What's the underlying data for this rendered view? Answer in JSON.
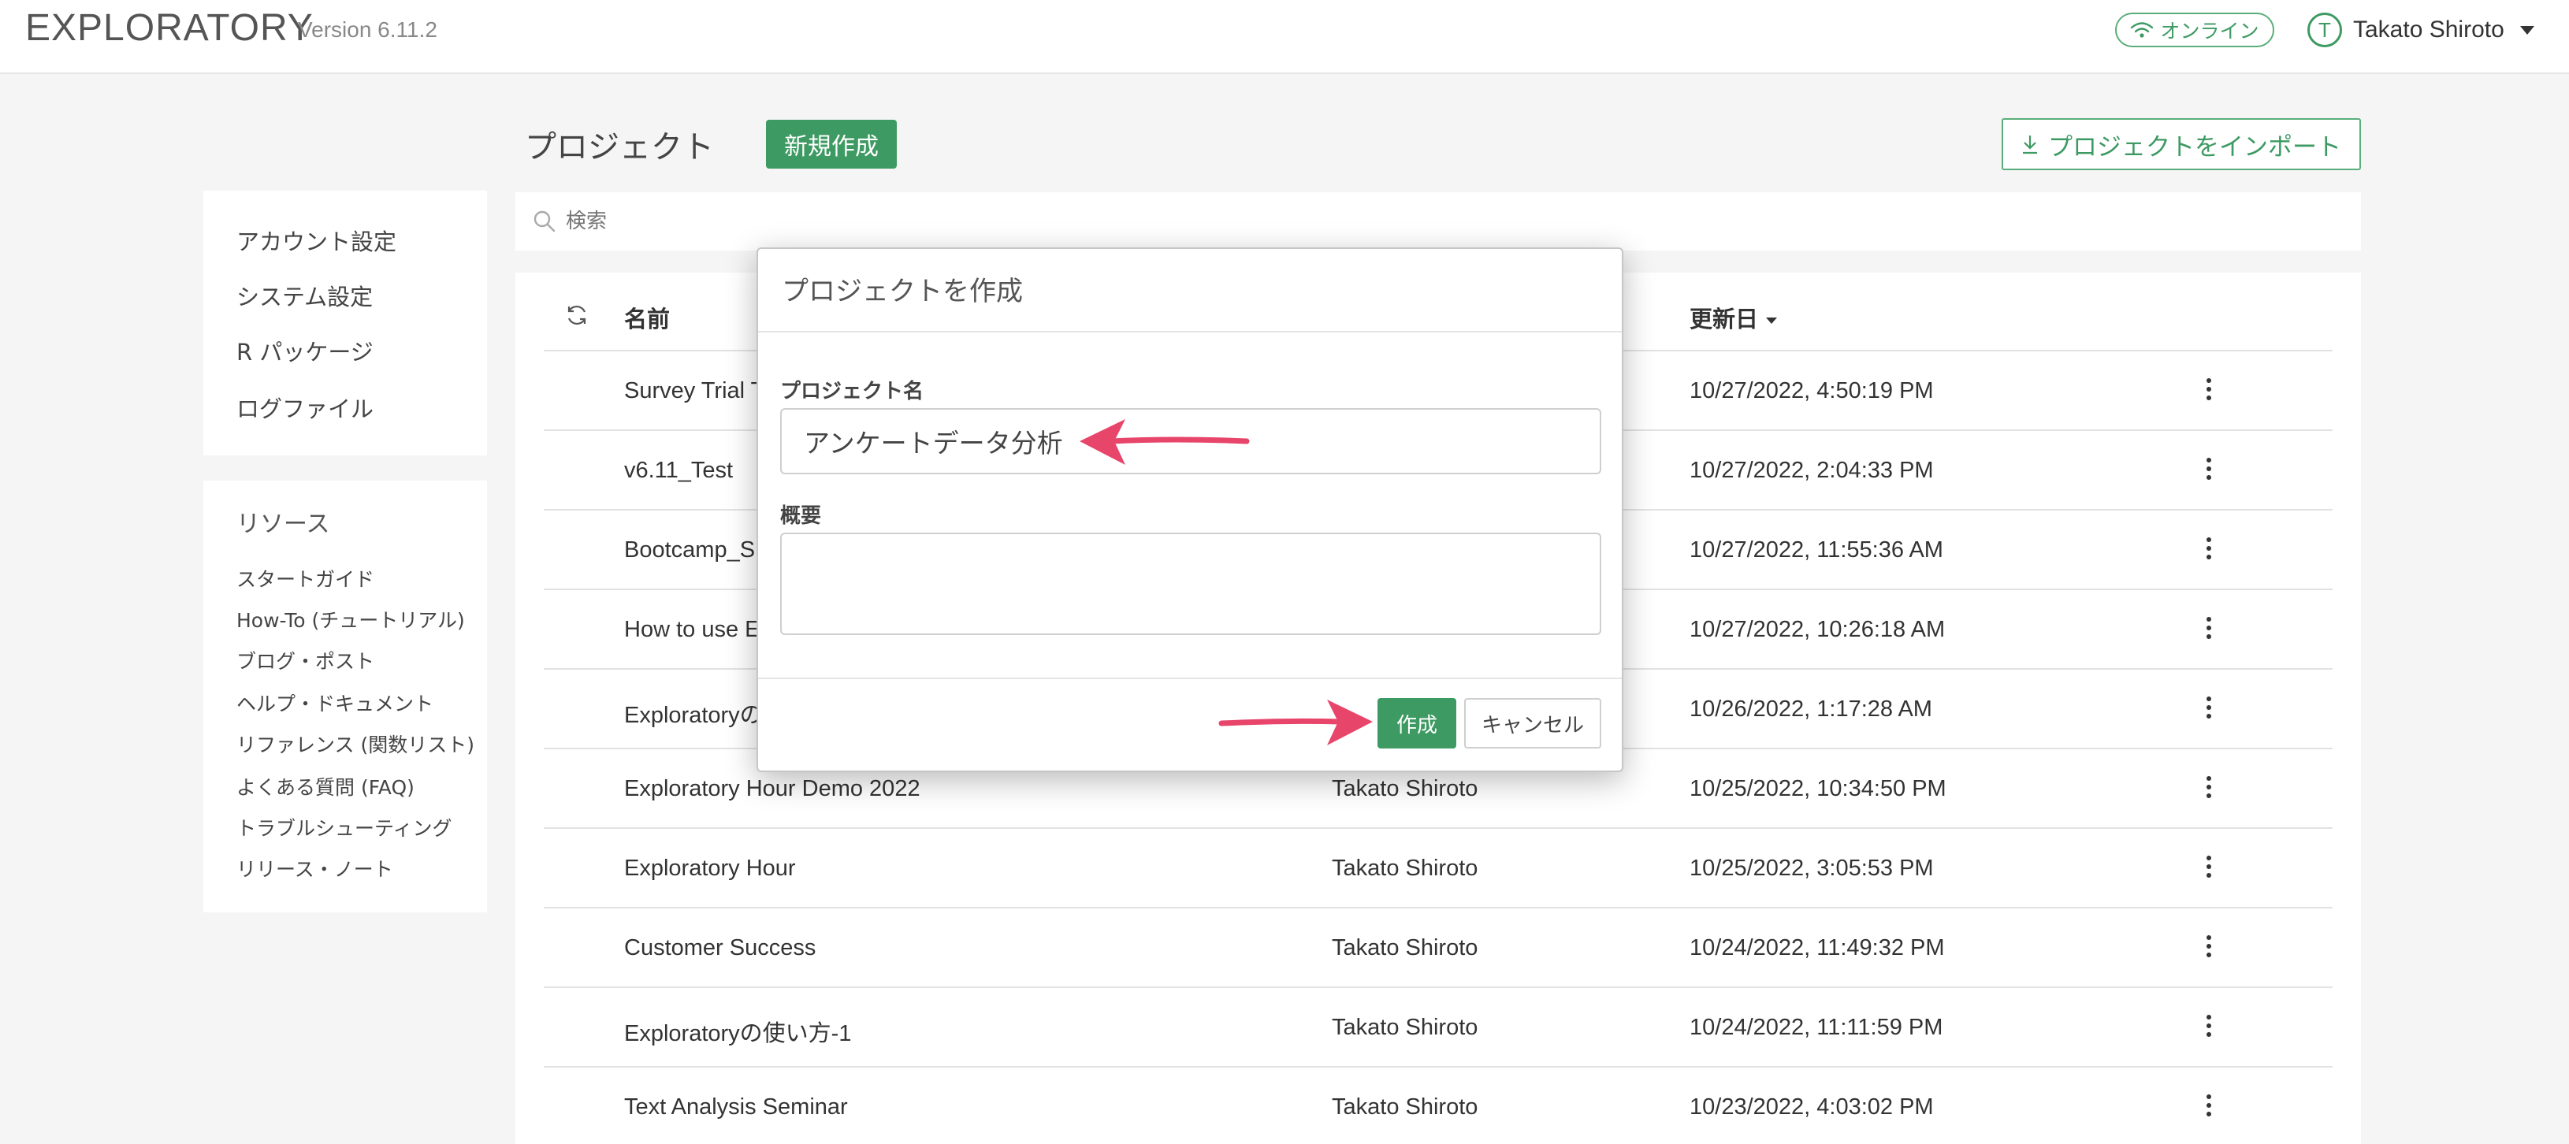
{
  "app": {
    "brand": "EXPLORATORY",
    "version": "Version 6.11.2"
  },
  "header": {
    "online_label": "オンライン",
    "avatar_initial": "T",
    "user_name": "Takato Shiroto"
  },
  "sidebar": {
    "settings": [
      {
        "label": "アカウント設定"
      },
      {
        "label": "システム設定"
      },
      {
        "label": "R パッケージ"
      },
      {
        "label": "ログファイル"
      }
    ],
    "resources_title": "リソース",
    "resources": [
      {
        "label": "スタートガイド"
      },
      {
        "label": "How-To (チュートリアル)"
      },
      {
        "label": "ブログ・ポスト"
      },
      {
        "label": "ヘルプ・ドキュメント"
      },
      {
        "label": "リファレンス (関数リスト)"
      },
      {
        "label": "よくある質問 (FAQ)"
      },
      {
        "label": "トラブルシューティング"
      },
      {
        "label": "リリース・ノート"
      }
    ]
  },
  "main": {
    "title": "プロジェクト",
    "new_button": "新規作成",
    "import_button": "プロジェクトをインポート",
    "search_placeholder": "検索",
    "columns": {
      "name": "名前",
      "updated": "更新日"
    },
    "rows": [
      {
        "name": "Survey Trial T",
        "owner": "",
        "updated": "10/27/2022, 4:50:19 PM"
      },
      {
        "name": "v6.11_Test",
        "owner": "",
        "updated": "10/27/2022, 2:04:33 PM"
      },
      {
        "name": "Bootcamp_S",
        "owner": "",
        "updated": "10/27/2022, 11:55:36 AM"
      },
      {
        "name": "How to use E",
        "owner": "",
        "updated": "10/27/2022, 10:26:18 AM"
      },
      {
        "name": "Exploratoryの",
        "owner": "",
        "updated": "10/26/2022, 1:17:28 AM"
      },
      {
        "name": "Exploratory Hour Demo 2022",
        "owner": "Takato Shiroto",
        "updated": "10/25/2022, 10:34:50 PM"
      },
      {
        "name": "Exploratory Hour",
        "owner": "Takato Shiroto",
        "updated": "10/25/2022, 3:05:53 PM"
      },
      {
        "name": "Customer Success",
        "owner": "Takato Shiroto",
        "updated": "10/24/2022, 11:49:32 PM"
      },
      {
        "name": "Exploratoryの使い方-1",
        "owner": "Takato Shiroto",
        "updated": "10/24/2022, 11:11:59 PM"
      },
      {
        "name": "Text Analysis Seminar",
        "owner": "Takato Shiroto",
        "updated": "10/23/2022, 4:03:02 PM"
      }
    ]
  },
  "modal": {
    "title": "プロジェクトを作成",
    "name_label": "プロジェクト名",
    "name_value": "アンケートデータ分析",
    "desc_label": "概要",
    "desc_value": "",
    "create_button": "作成",
    "cancel_button": "キャンセル"
  },
  "colors": {
    "accent": "#3d9a62",
    "annotation_arrow": "#e8456b"
  }
}
